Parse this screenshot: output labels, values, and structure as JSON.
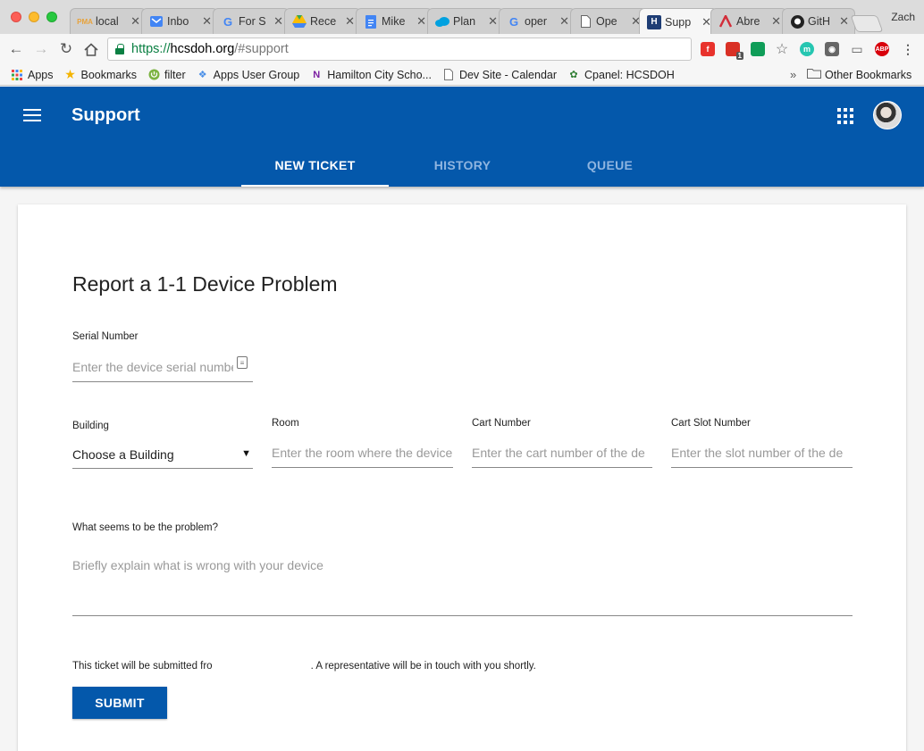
{
  "browser": {
    "profile_name": "Zach",
    "tabs": [
      {
        "label": "localhost / localhost | phpMyAdmin",
        "short": "local",
        "icon": "phpmyadmin-icon"
      },
      {
        "label": "Inbox",
        "short": "Inbo",
        "icon": "inbox-icon"
      },
      {
        "label": "For S...",
        "short": "For S",
        "icon": "google-icon"
      },
      {
        "label": "Recent",
        "short": "Rece",
        "icon": "google-drive-icon"
      },
      {
        "label": "Mike",
        "short": "Mike",
        "icon": "google-docs-icon"
      },
      {
        "label": "Plan",
        "short": "Plan",
        "icon": "cloud-icon"
      },
      {
        "label": "open",
        "short": "oper",
        "icon": "google-icon"
      },
      {
        "label": "Open",
        "short": "Ope",
        "icon": "page-icon"
      },
      {
        "label": "Support",
        "short": "Supp",
        "icon": "hcsdoh-icon",
        "active": true
      },
      {
        "label": "Abre",
        "short": "Abre",
        "icon": "abre-icon"
      },
      {
        "label": "GitHub",
        "short": "GitH",
        "icon": "github-icon"
      }
    ],
    "url": {
      "scheme": "https://",
      "host": "hcsdoh.org",
      "rest": "/#support"
    },
    "bookmarks": [
      {
        "label": "Apps",
        "icon": "apps-grid-icon"
      },
      {
        "label": "Bookmarks",
        "icon": "star-icon"
      },
      {
        "label": "filter",
        "icon": "power-icon"
      },
      {
        "label": "Apps User Group",
        "icon": "dropbox-icon"
      },
      {
        "label": "Hamilton City Scho...",
        "icon": "school-logo-icon"
      },
      {
        "label": "Dev Site - Calendar",
        "icon": "page-icon"
      },
      {
        "label": "Cpanel: HCSDOH",
        "icon": "cpanel-icon"
      }
    ],
    "bookmarks_overflow": "»",
    "other_bookmarks": "Other Bookmarks",
    "extensions": {
      "notif_count": "1",
      "abp": "ABP",
      "m": "m"
    }
  },
  "app": {
    "title": "Support",
    "tabs": [
      {
        "label": "NEW TICKET",
        "active": true
      },
      {
        "label": "HISTORY",
        "active": false
      },
      {
        "label": "QUEUE",
        "active": false
      }
    ]
  },
  "form": {
    "title": "Report a 1-1 Device Problem",
    "serial": {
      "label": "Serial Number",
      "placeholder": "Enter the device serial number"
    },
    "building": {
      "label": "Building",
      "value": "Choose a Building"
    },
    "room": {
      "label": "Room",
      "placeholder": "Enter the room where the device"
    },
    "cart": {
      "label": "Cart Number",
      "placeholder": "Enter the cart number of the de"
    },
    "slot": {
      "label": "Cart Slot Number",
      "placeholder": "Enter the slot number of the de"
    },
    "problem": {
      "label": "What seems to be the problem?",
      "placeholder": "Briefly explain what is wrong with your device"
    },
    "note_before": "This ticket will be submitted fro",
    "note_after": ". A representative will be in touch with you shortly.",
    "submit_label": "SUBMIT"
  },
  "colors": {
    "brand": "#0458ab",
    "tab_inactive": "#8fb5e0"
  }
}
